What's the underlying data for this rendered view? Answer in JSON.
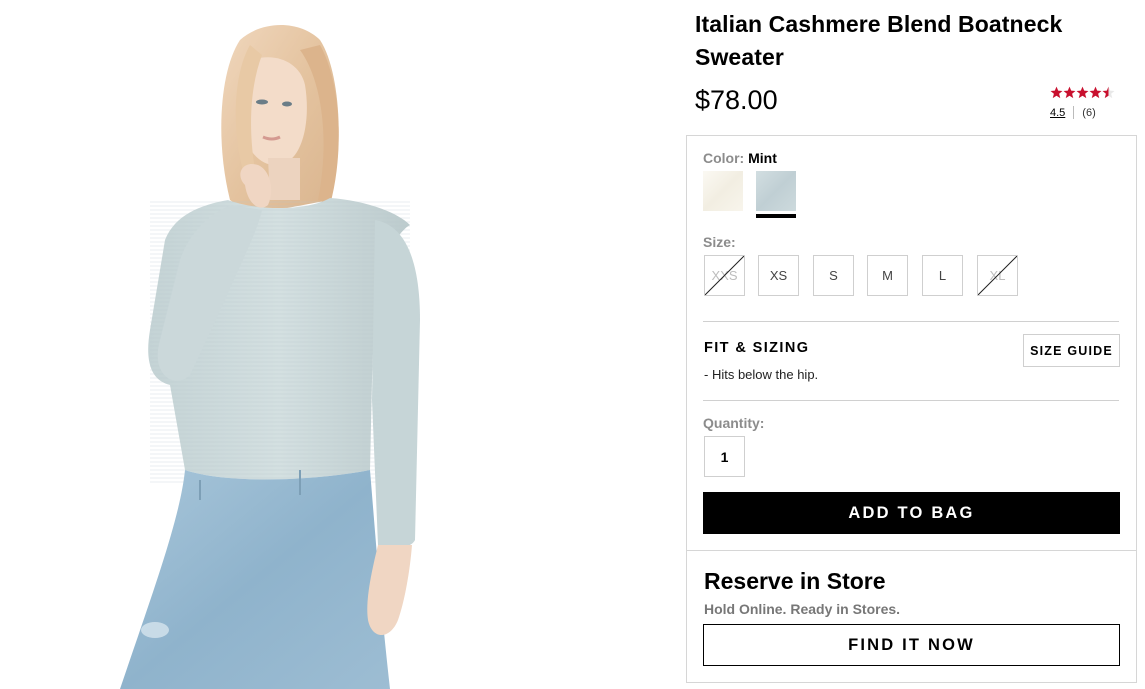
{
  "product": {
    "title": "Italian Cashmere Blend Boatneck Sweater",
    "price": "$78.00",
    "image_alt": "Model wearing mint boatneck sweater and light-wash jeans"
  },
  "rating": {
    "value": "4.5",
    "count": "(6)",
    "stars": 4.5,
    "star_color": "#c8102e"
  },
  "color": {
    "label": "Color:",
    "selected": "Mint",
    "swatches": [
      {
        "name": "Cream",
        "color": "#f6f3ea"
      },
      {
        "name": "Mint",
        "color": "#c9d6da"
      }
    ]
  },
  "size": {
    "label": "Size:",
    "options": [
      {
        "label": "XXS",
        "available": false
      },
      {
        "label": "XS",
        "available": true
      },
      {
        "label": "S",
        "available": true
      },
      {
        "label": "M",
        "available": true
      },
      {
        "label": "L",
        "available": true
      },
      {
        "label": "XL",
        "available": false
      }
    ]
  },
  "fit": {
    "title": "FIT & SIZING",
    "note": "-  Hits below the hip.",
    "size_guide_label": "SIZE GUIDE"
  },
  "quantity": {
    "label": "Quantity:",
    "value": "1"
  },
  "actions": {
    "add_to_bag": "ADD TO BAG"
  },
  "reserve": {
    "title": "Reserve in Store",
    "subtitle": "Hold Online. Ready in Stores.",
    "find_button": "FIND IT NOW"
  }
}
